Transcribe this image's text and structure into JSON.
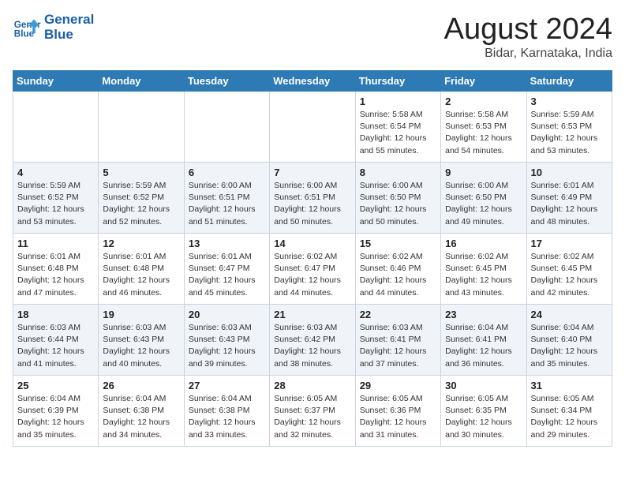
{
  "header": {
    "logo_line1": "General",
    "logo_line2": "Blue",
    "title": "August 2024",
    "subtitle": "Bidar, Karnataka, India"
  },
  "weekdays": [
    "Sunday",
    "Monday",
    "Tuesday",
    "Wednesday",
    "Thursday",
    "Friday",
    "Saturday"
  ],
  "weeks": [
    [
      {
        "day": "",
        "info": ""
      },
      {
        "day": "",
        "info": ""
      },
      {
        "day": "",
        "info": ""
      },
      {
        "day": "",
        "info": ""
      },
      {
        "day": "1",
        "info": "Sunrise: 5:58 AM\nSunset: 6:54 PM\nDaylight: 12 hours\nand 55 minutes."
      },
      {
        "day": "2",
        "info": "Sunrise: 5:58 AM\nSunset: 6:53 PM\nDaylight: 12 hours\nand 54 minutes."
      },
      {
        "day": "3",
        "info": "Sunrise: 5:59 AM\nSunset: 6:53 PM\nDaylight: 12 hours\nand 53 minutes."
      }
    ],
    [
      {
        "day": "4",
        "info": "Sunrise: 5:59 AM\nSunset: 6:52 PM\nDaylight: 12 hours\nand 53 minutes."
      },
      {
        "day": "5",
        "info": "Sunrise: 5:59 AM\nSunset: 6:52 PM\nDaylight: 12 hours\nand 52 minutes."
      },
      {
        "day": "6",
        "info": "Sunrise: 6:00 AM\nSunset: 6:51 PM\nDaylight: 12 hours\nand 51 minutes."
      },
      {
        "day": "7",
        "info": "Sunrise: 6:00 AM\nSunset: 6:51 PM\nDaylight: 12 hours\nand 50 minutes."
      },
      {
        "day": "8",
        "info": "Sunrise: 6:00 AM\nSunset: 6:50 PM\nDaylight: 12 hours\nand 50 minutes."
      },
      {
        "day": "9",
        "info": "Sunrise: 6:00 AM\nSunset: 6:50 PM\nDaylight: 12 hours\nand 49 minutes."
      },
      {
        "day": "10",
        "info": "Sunrise: 6:01 AM\nSunset: 6:49 PM\nDaylight: 12 hours\nand 48 minutes."
      }
    ],
    [
      {
        "day": "11",
        "info": "Sunrise: 6:01 AM\nSunset: 6:48 PM\nDaylight: 12 hours\nand 47 minutes."
      },
      {
        "day": "12",
        "info": "Sunrise: 6:01 AM\nSunset: 6:48 PM\nDaylight: 12 hours\nand 46 minutes."
      },
      {
        "day": "13",
        "info": "Sunrise: 6:01 AM\nSunset: 6:47 PM\nDaylight: 12 hours\nand 45 minutes."
      },
      {
        "day": "14",
        "info": "Sunrise: 6:02 AM\nSunset: 6:47 PM\nDaylight: 12 hours\nand 44 minutes."
      },
      {
        "day": "15",
        "info": "Sunrise: 6:02 AM\nSunset: 6:46 PM\nDaylight: 12 hours\nand 44 minutes."
      },
      {
        "day": "16",
        "info": "Sunrise: 6:02 AM\nSunset: 6:45 PM\nDaylight: 12 hours\nand 43 minutes."
      },
      {
        "day": "17",
        "info": "Sunrise: 6:02 AM\nSunset: 6:45 PM\nDaylight: 12 hours\nand 42 minutes."
      }
    ],
    [
      {
        "day": "18",
        "info": "Sunrise: 6:03 AM\nSunset: 6:44 PM\nDaylight: 12 hours\nand 41 minutes."
      },
      {
        "day": "19",
        "info": "Sunrise: 6:03 AM\nSunset: 6:43 PM\nDaylight: 12 hours\nand 40 minutes."
      },
      {
        "day": "20",
        "info": "Sunrise: 6:03 AM\nSunset: 6:43 PM\nDaylight: 12 hours\nand 39 minutes."
      },
      {
        "day": "21",
        "info": "Sunrise: 6:03 AM\nSunset: 6:42 PM\nDaylight: 12 hours\nand 38 minutes."
      },
      {
        "day": "22",
        "info": "Sunrise: 6:03 AM\nSunset: 6:41 PM\nDaylight: 12 hours\nand 37 minutes."
      },
      {
        "day": "23",
        "info": "Sunrise: 6:04 AM\nSunset: 6:41 PM\nDaylight: 12 hours\nand 36 minutes."
      },
      {
        "day": "24",
        "info": "Sunrise: 6:04 AM\nSunset: 6:40 PM\nDaylight: 12 hours\nand 35 minutes."
      }
    ],
    [
      {
        "day": "25",
        "info": "Sunrise: 6:04 AM\nSunset: 6:39 PM\nDaylight: 12 hours\nand 35 minutes."
      },
      {
        "day": "26",
        "info": "Sunrise: 6:04 AM\nSunset: 6:38 PM\nDaylight: 12 hours\nand 34 minutes."
      },
      {
        "day": "27",
        "info": "Sunrise: 6:04 AM\nSunset: 6:38 PM\nDaylight: 12 hours\nand 33 minutes."
      },
      {
        "day": "28",
        "info": "Sunrise: 6:05 AM\nSunset: 6:37 PM\nDaylight: 12 hours\nand 32 minutes."
      },
      {
        "day": "29",
        "info": "Sunrise: 6:05 AM\nSunset: 6:36 PM\nDaylight: 12 hours\nand 31 minutes."
      },
      {
        "day": "30",
        "info": "Sunrise: 6:05 AM\nSunset: 6:35 PM\nDaylight: 12 hours\nand 30 minutes."
      },
      {
        "day": "31",
        "info": "Sunrise: 6:05 AM\nSunset: 6:34 PM\nDaylight: 12 hours\nand 29 minutes."
      }
    ]
  ]
}
